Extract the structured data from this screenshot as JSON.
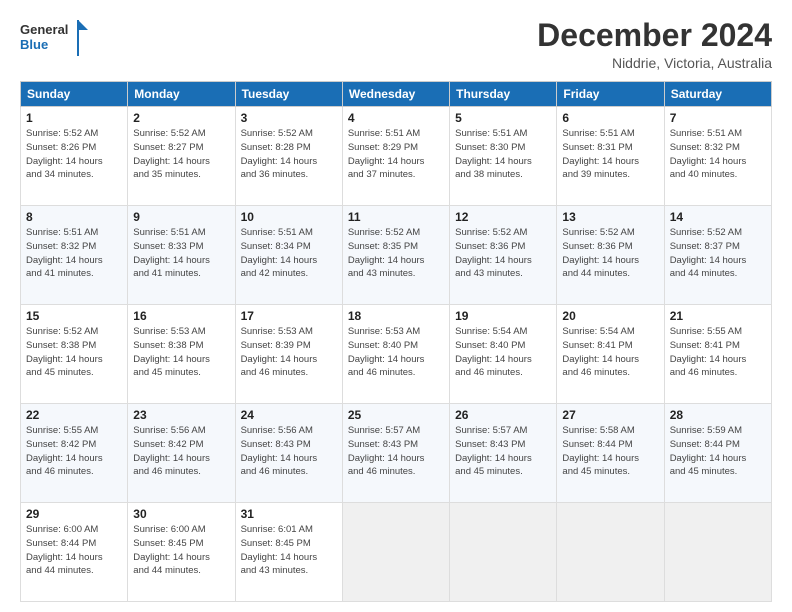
{
  "logo": {
    "line1": "General",
    "line2": "Blue"
  },
  "title": "December 2024",
  "location": "Niddrie, Victoria, Australia",
  "days_of_week": [
    "Sunday",
    "Monday",
    "Tuesday",
    "Wednesday",
    "Thursday",
    "Friday",
    "Saturday"
  ],
  "weeks": [
    [
      {
        "day": "1",
        "info": "Sunrise: 5:52 AM\nSunset: 8:26 PM\nDaylight: 14 hours\nand 34 minutes."
      },
      {
        "day": "2",
        "info": "Sunrise: 5:52 AM\nSunset: 8:27 PM\nDaylight: 14 hours\nand 35 minutes."
      },
      {
        "day": "3",
        "info": "Sunrise: 5:52 AM\nSunset: 8:28 PM\nDaylight: 14 hours\nand 36 minutes."
      },
      {
        "day": "4",
        "info": "Sunrise: 5:51 AM\nSunset: 8:29 PM\nDaylight: 14 hours\nand 37 minutes."
      },
      {
        "day": "5",
        "info": "Sunrise: 5:51 AM\nSunset: 8:30 PM\nDaylight: 14 hours\nand 38 minutes."
      },
      {
        "day": "6",
        "info": "Sunrise: 5:51 AM\nSunset: 8:31 PM\nDaylight: 14 hours\nand 39 minutes."
      },
      {
        "day": "7",
        "info": "Sunrise: 5:51 AM\nSunset: 8:32 PM\nDaylight: 14 hours\nand 40 minutes."
      }
    ],
    [
      {
        "day": "8",
        "info": "Sunrise: 5:51 AM\nSunset: 8:32 PM\nDaylight: 14 hours\nand 41 minutes."
      },
      {
        "day": "9",
        "info": "Sunrise: 5:51 AM\nSunset: 8:33 PM\nDaylight: 14 hours\nand 41 minutes."
      },
      {
        "day": "10",
        "info": "Sunrise: 5:51 AM\nSunset: 8:34 PM\nDaylight: 14 hours\nand 42 minutes."
      },
      {
        "day": "11",
        "info": "Sunrise: 5:52 AM\nSunset: 8:35 PM\nDaylight: 14 hours\nand 43 minutes."
      },
      {
        "day": "12",
        "info": "Sunrise: 5:52 AM\nSunset: 8:36 PM\nDaylight: 14 hours\nand 43 minutes."
      },
      {
        "day": "13",
        "info": "Sunrise: 5:52 AM\nSunset: 8:36 PM\nDaylight: 14 hours\nand 44 minutes."
      },
      {
        "day": "14",
        "info": "Sunrise: 5:52 AM\nSunset: 8:37 PM\nDaylight: 14 hours\nand 44 minutes."
      }
    ],
    [
      {
        "day": "15",
        "info": "Sunrise: 5:52 AM\nSunset: 8:38 PM\nDaylight: 14 hours\nand 45 minutes."
      },
      {
        "day": "16",
        "info": "Sunrise: 5:53 AM\nSunset: 8:38 PM\nDaylight: 14 hours\nand 45 minutes."
      },
      {
        "day": "17",
        "info": "Sunrise: 5:53 AM\nSunset: 8:39 PM\nDaylight: 14 hours\nand 46 minutes."
      },
      {
        "day": "18",
        "info": "Sunrise: 5:53 AM\nSunset: 8:40 PM\nDaylight: 14 hours\nand 46 minutes."
      },
      {
        "day": "19",
        "info": "Sunrise: 5:54 AM\nSunset: 8:40 PM\nDaylight: 14 hours\nand 46 minutes."
      },
      {
        "day": "20",
        "info": "Sunrise: 5:54 AM\nSunset: 8:41 PM\nDaylight: 14 hours\nand 46 minutes."
      },
      {
        "day": "21",
        "info": "Sunrise: 5:55 AM\nSunset: 8:41 PM\nDaylight: 14 hours\nand 46 minutes."
      }
    ],
    [
      {
        "day": "22",
        "info": "Sunrise: 5:55 AM\nSunset: 8:42 PM\nDaylight: 14 hours\nand 46 minutes."
      },
      {
        "day": "23",
        "info": "Sunrise: 5:56 AM\nSunset: 8:42 PM\nDaylight: 14 hours\nand 46 minutes."
      },
      {
        "day": "24",
        "info": "Sunrise: 5:56 AM\nSunset: 8:43 PM\nDaylight: 14 hours\nand 46 minutes."
      },
      {
        "day": "25",
        "info": "Sunrise: 5:57 AM\nSunset: 8:43 PM\nDaylight: 14 hours\nand 46 minutes."
      },
      {
        "day": "26",
        "info": "Sunrise: 5:57 AM\nSunset: 8:43 PM\nDaylight: 14 hours\nand 45 minutes."
      },
      {
        "day": "27",
        "info": "Sunrise: 5:58 AM\nSunset: 8:44 PM\nDaylight: 14 hours\nand 45 minutes."
      },
      {
        "day": "28",
        "info": "Sunrise: 5:59 AM\nSunset: 8:44 PM\nDaylight: 14 hours\nand 45 minutes."
      }
    ],
    [
      {
        "day": "29",
        "info": "Sunrise: 6:00 AM\nSunset: 8:44 PM\nDaylight: 14 hours\nand 44 minutes."
      },
      {
        "day": "30",
        "info": "Sunrise: 6:00 AM\nSunset: 8:45 PM\nDaylight: 14 hours\nand 44 minutes."
      },
      {
        "day": "31",
        "info": "Sunrise: 6:01 AM\nSunset: 8:45 PM\nDaylight: 14 hours\nand 43 minutes."
      },
      {
        "day": "",
        "info": ""
      },
      {
        "day": "",
        "info": ""
      },
      {
        "day": "",
        "info": ""
      },
      {
        "day": "",
        "info": ""
      }
    ]
  ]
}
